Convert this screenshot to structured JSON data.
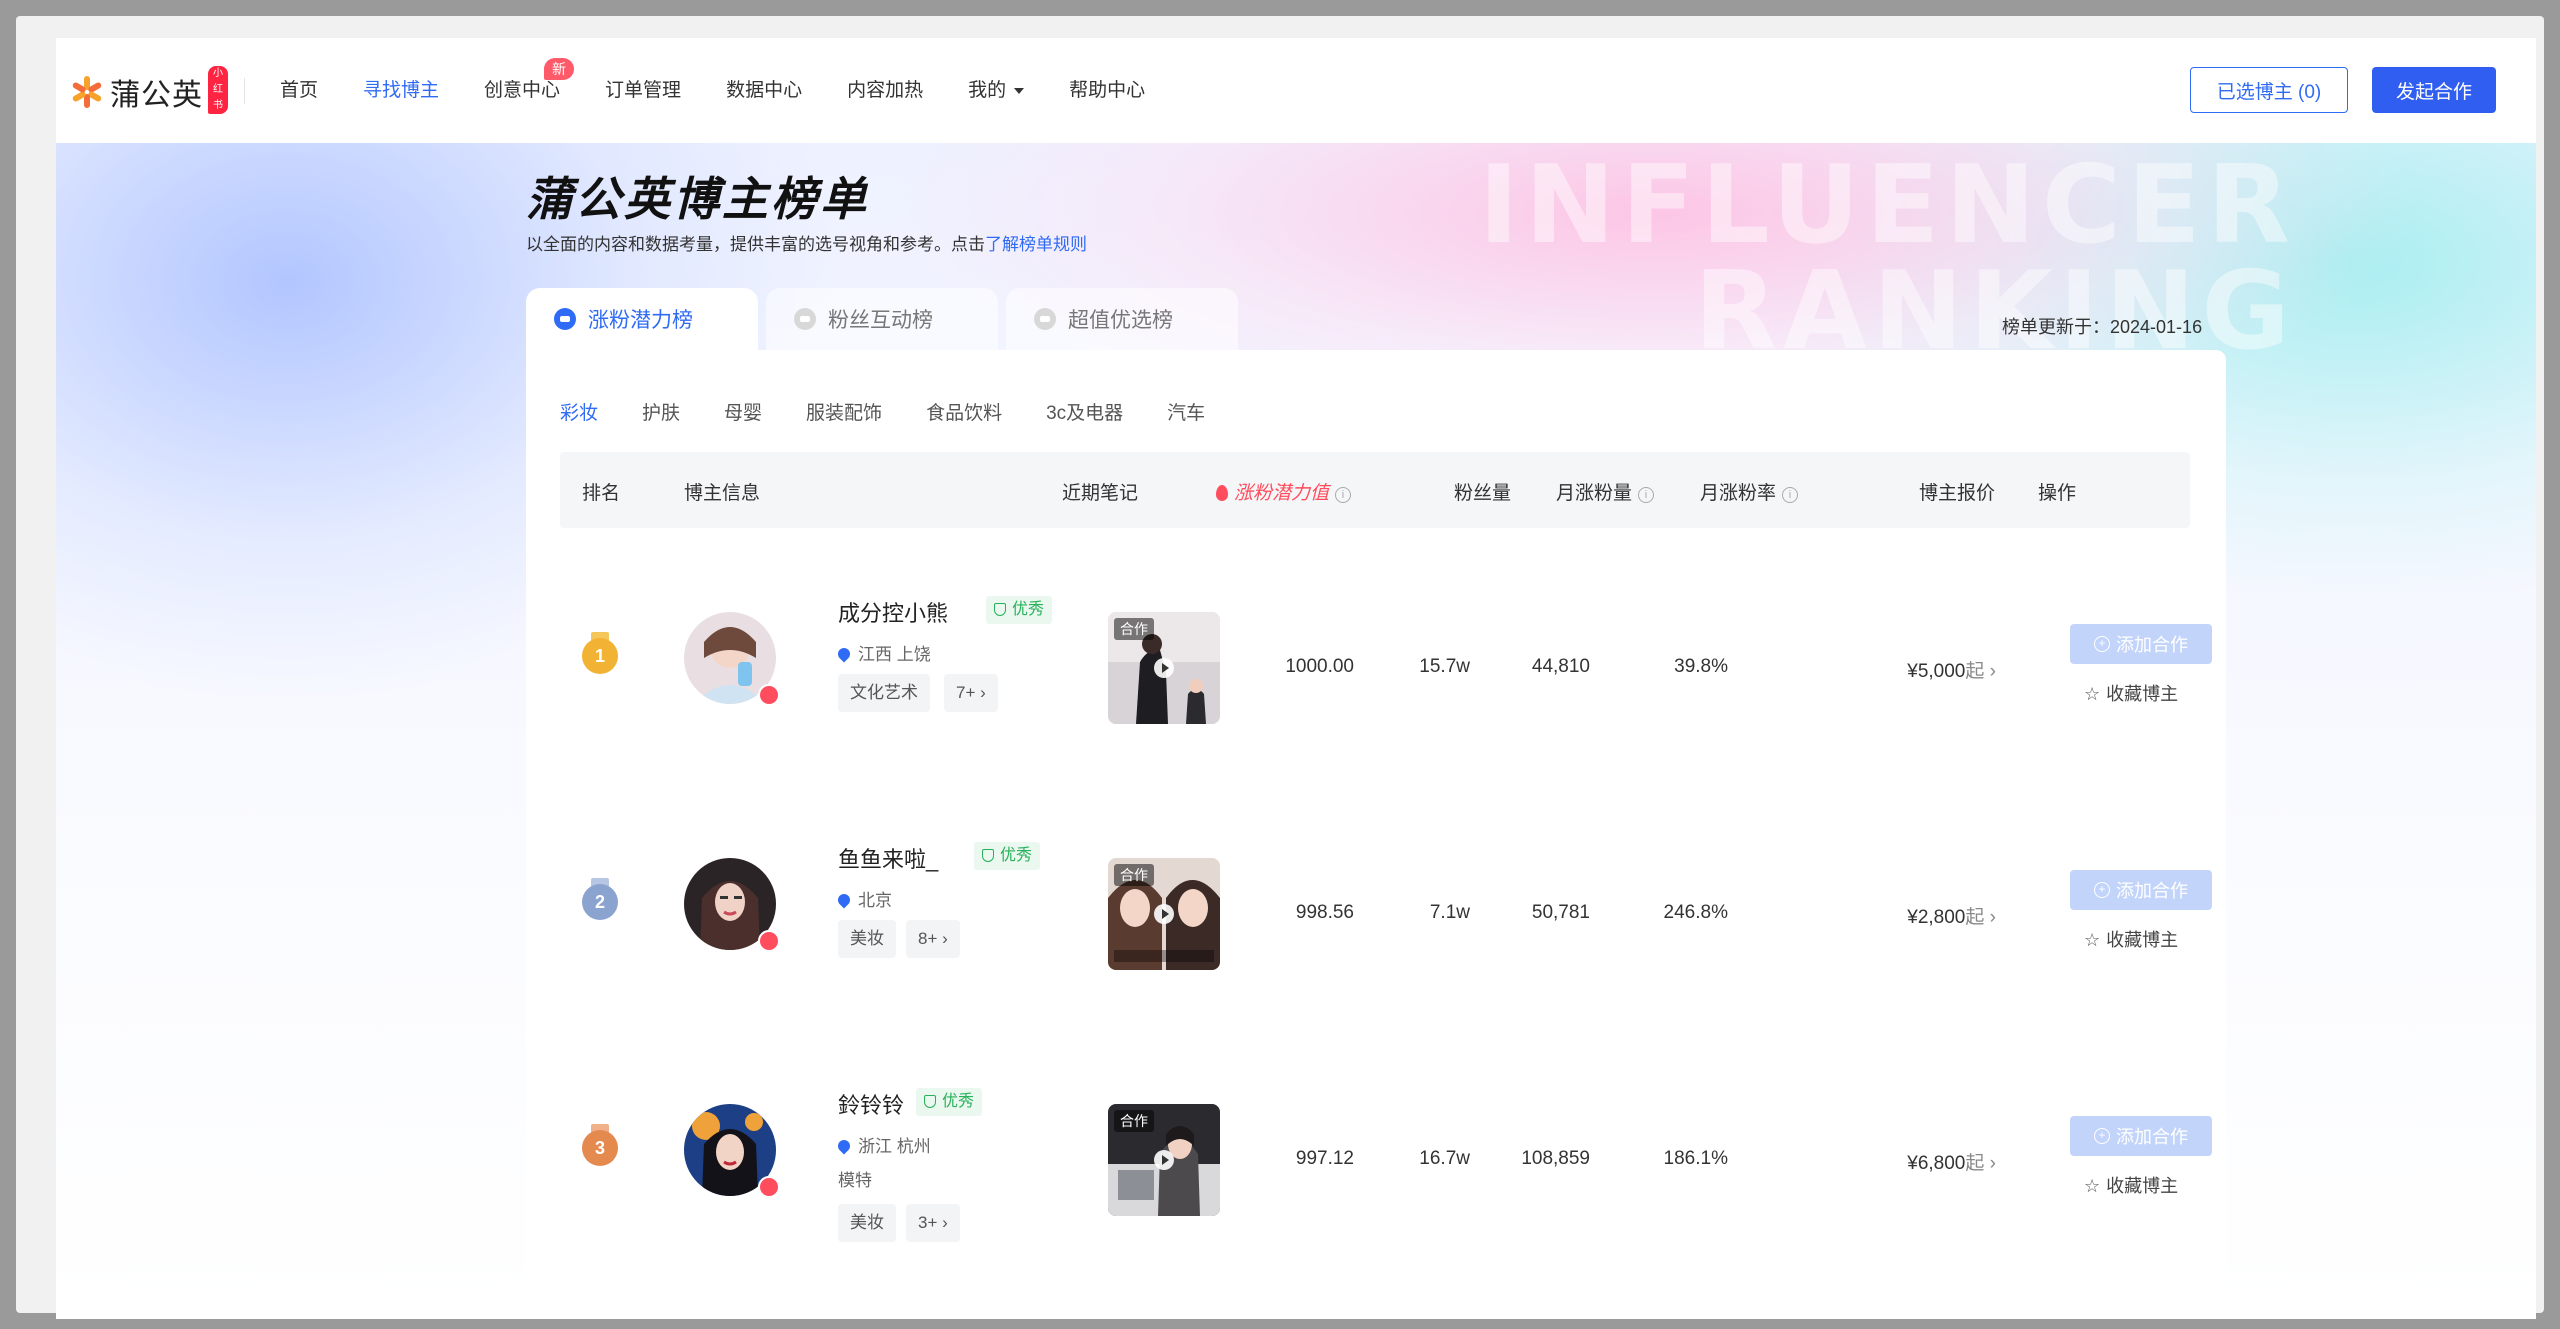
{
  "nav": {
    "logo_text": "蒲公英",
    "logo_badge": "小红书",
    "items": [
      {
        "label": "首页"
      },
      {
        "label": "寻找博主",
        "active": true
      },
      {
        "label": "创意中心",
        "badge": "新"
      },
      {
        "label": "订单管理"
      },
      {
        "label": "数据中心"
      },
      {
        "label": "内容加热"
      },
      {
        "label": "我的",
        "dropdown": true
      },
      {
        "label": "帮助中心"
      }
    ],
    "selected_button": "已选博主 (0)",
    "start_button": "发起合作"
  },
  "hero": {
    "title": "蒲公英博主榜单",
    "subtitle": "以全面的内容和数据考量，提供丰富的选号视角和参考。点击",
    "rules_link": "了解榜单规则",
    "watermark_line1": "INFLUENCER",
    "watermark_line2": "RANKING"
  },
  "tabs": [
    {
      "label": "涨粉潜力榜",
      "active": true
    },
    {
      "label": "粉丝互动榜"
    },
    {
      "label": "超值优选榜"
    }
  ],
  "updated": "榜单更新于：2024-01-16",
  "categories": [
    {
      "label": "彩妆",
      "active": true
    },
    {
      "label": "护肤"
    },
    {
      "label": "母婴"
    },
    {
      "label": "服装配饰"
    },
    {
      "label": "食品饮料"
    },
    {
      "label": "3c及电器"
    },
    {
      "label": "汽车"
    }
  ],
  "columns": {
    "rank": "排名",
    "info": "博主信息",
    "notes": "近期笔记",
    "potential": "涨粉潜力值",
    "followers": "粉丝量",
    "monthly_gain": "月涨粉量",
    "monthly_rate": "月涨粉率",
    "price": "博主报价",
    "actions": "操作"
  },
  "rows": [
    {
      "rank": "1",
      "name": "成分控小熊",
      "badge": "优秀",
      "location": "江西 上饶",
      "extra": "",
      "tag": "文化艺术",
      "more": "7+ ›",
      "thumb_label": "合作",
      "potential": "1000.00",
      "followers": "15.7w",
      "monthly_gain": "44,810",
      "monthly_rate": "39.8%",
      "price": "¥5,000",
      "price_suffix": "起 ›",
      "add_label": "添加合作",
      "fav_label": "收藏博主"
    },
    {
      "rank": "2",
      "name": "鱼鱼来啦_",
      "badge": "优秀",
      "location": "北京",
      "extra": "",
      "tag": "美妆",
      "more": "8+ ›",
      "thumb_label": "合作",
      "potential": "998.56",
      "followers": "7.1w",
      "monthly_gain": "50,781",
      "monthly_rate": "246.8%",
      "price": "¥2,800",
      "price_suffix": "起 ›",
      "add_label": "添加合作",
      "fav_label": "收藏博主"
    },
    {
      "rank": "3",
      "name": "鈴铃铃",
      "badge": "优秀",
      "location": "浙江 杭州",
      "extra": "模特",
      "tag": "美妆",
      "more": "3+ ›",
      "thumb_label": "合作",
      "potential": "997.12",
      "followers": "16.7w",
      "monthly_gain": "108,859",
      "monthly_rate": "186.1%",
      "price": "¥6,800",
      "price_suffix": "起 ›",
      "add_label": "添加合作",
      "fav_label": "收藏博主"
    }
  ],
  "colors": {
    "accent": "#2f6bf5",
    "hot": "#ff4d5e",
    "gold": "#f2b233",
    "silver": "#8aa3cf",
    "bronze": "#e58a4e",
    "success": "#27b15a"
  }
}
